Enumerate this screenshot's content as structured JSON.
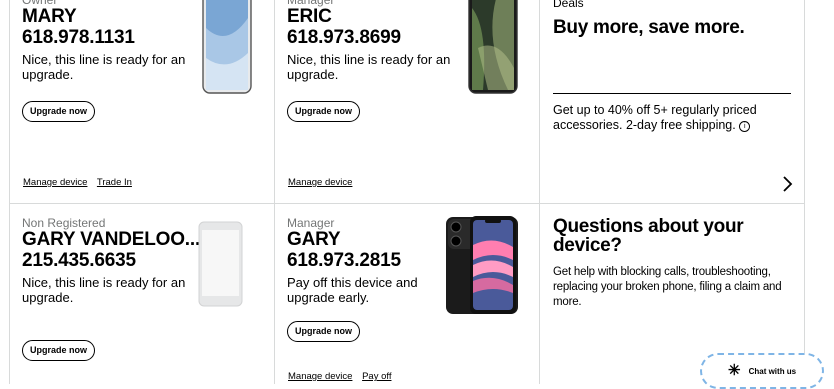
{
  "lines": [
    {
      "role": "Owner",
      "name": "MARY",
      "number": "618.978.1131",
      "message": "Nice, this line is ready for an upgrade.",
      "button": "Upgrade now",
      "links": [
        "Manage device",
        "Trade In"
      ],
      "device": "white-iphone-xr"
    },
    {
      "role": "Manager",
      "name": "ERIC",
      "number": "618.973.8699",
      "message": "Nice, this line is ready for an upgrade.",
      "button": "Upgrade now",
      "links": [
        "Manage device"
      ],
      "device": "space-gray-iphone-xs"
    },
    {
      "role": "Non Registered",
      "name": "GARY VANDELOO...",
      "number": "215.435.6635",
      "message": "Nice, this line is ready for an upgrade.",
      "button": "Upgrade now",
      "links": [],
      "device": "generic-phone-placeholder"
    },
    {
      "role": "Manager",
      "name": "GARY",
      "number": "618.973.2815",
      "message": "Pay off this device and upgrade early.",
      "button": "Upgrade now",
      "links": [
        "Manage device",
        "Pay off"
      ],
      "device": "black-iphone-11"
    }
  ],
  "deals": {
    "label": "Deals",
    "title": "Buy more, save more.",
    "text": "Get up to 40% off 5+ regularly priced accessories. 2-day free shipping.",
    "info_icon": "info-circle-icon",
    "arrow_icon": "chevron-right-icon"
  },
  "questions": {
    "title": "Questions about your device?",
    "text": "Get help with blocking calls, troubleshooting, replacing your broken phone, filing a claim and more."
  },
  "chat": {
    "label": "Chat with us",
    "icon": "chat-sparkle-icon"
  },
  "colors": {
    "divider": "#d8dada",
    "secondary_text": "#747676",
    "chat_border": "#7fb5e6"
  }
}
